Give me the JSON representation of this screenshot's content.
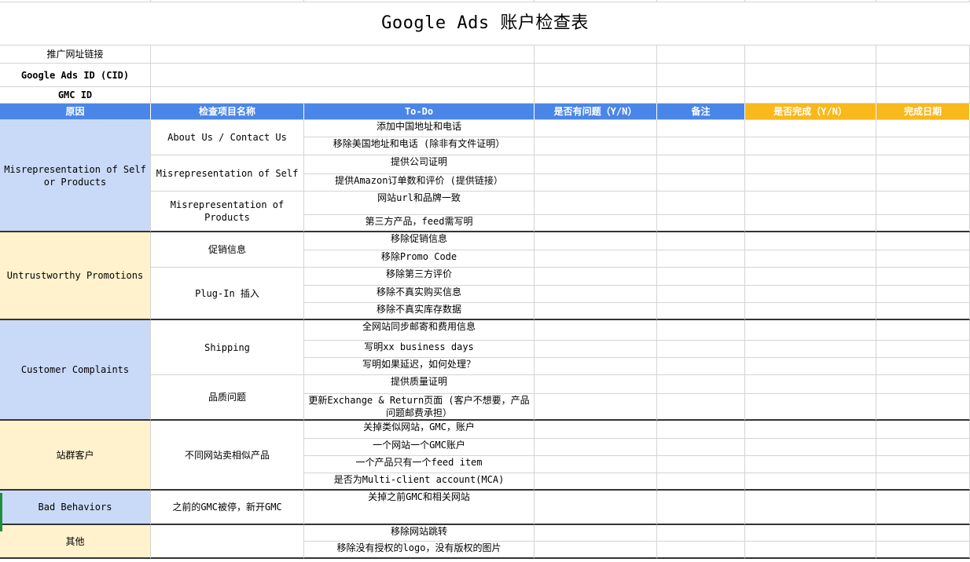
{
  "title": "Google Ads 账户检查表",
  "info_rows": [
    {
      "label": "推广网址链接",
      "bold": false
    },
    {
      "label": "Google Ads ID (CID)",
      "bold": true
    },
    {
      "label": "GMC ID",
      "bold": true
    }
  ],
  "headers": [
    "原因",
    "检查项目名称",
    "To-Do",
    "是否有问题（Y/N）",
    "备注",
    "是否完成（Y/N）",
    "完成日期"
  ],
  "header_colors": {
    "blue": "#4a86e8",
    "gold": "#f9b81b"
  },
  "sections": [
    {
      "reason": "Misrepresentation of Self or Products",
      "color": "blue",
      "items": [
        {
          "name": "About Us / Contact Us",
          "todos": [
            "添加中国地址和电话",
            "移除美国地址和电话 (除非有文件证明）"
          ]
        },
        {
          "name": "Misrepresentation of Self",
          "todos": [
            "提供公司证明",
            "提供Amazon订单数和评价 (提供链接）"
          ]
        },
        {
          "name": "Misrepresentation of Products",
          "todos": [
            "网站url和品牌一致",
            "第三方产品，feed需写明"
          ]
        }
      ]
    },
    {
      "reason": "Untrustworthy Promotions",
      "color": "yellow",
      "items": [
        {
          "name": "促销信息",
          "todos": [
            "移除促销信息",
            "移除Promo Code"
          ]
        },
        {
          "name": "Plug-In 插入",
          "todos": [
            "移除第三方评价",
            "移除不真实购买信息",
            "移除不真实库存数据"
          ]
        }
      ]
    },
    {
      "reason": "Customer Complaints",
      "color": "blue",
      "items": [
        {
          "name": "Shipping",
          "todos": [
            "全网站同步邮寄和费用信息",
            "写明xx business days",
            "写明如果延迟，如何处理？"
          ]
        },
        {
          "name": "品质问题",
          "todos": [
            "提供质量证明",
            "更新Exchange & Return页面 (客户不想要，产品问题邮费承担）"
          ]
        }
      ]
    },
    {
      "reason": "站群客户",
      "color": "yellow",
      "items": [
        {
          "name": "不同网站卖相似产品",
          "todos": [
            "关掉类似网站，GMC，账户",
            "一个网站一个GMC账户",
            "一个产品只有一个feed item",
            "是否为Multi-client account(MCA)"
          ]
        }
      ]
    },
    {
      "reason": "Bad Behaviors",
      "color": "blue",
      "items": [
        {
          "name": "之前的GMC被停，新开GMC",
          "todos": [
            "关掉之前GMC和相关网站"
          ]
        }
      ]
    },
    {
      "reason": "其他",
      "color": "yellow",
      "items": [
        {
          "name": "",
          "todos": [
            "移除网站跳转",
            "移除没有授权的logo，没有版权的图片"
          ]
        }
      ]
    }
  ]
}
